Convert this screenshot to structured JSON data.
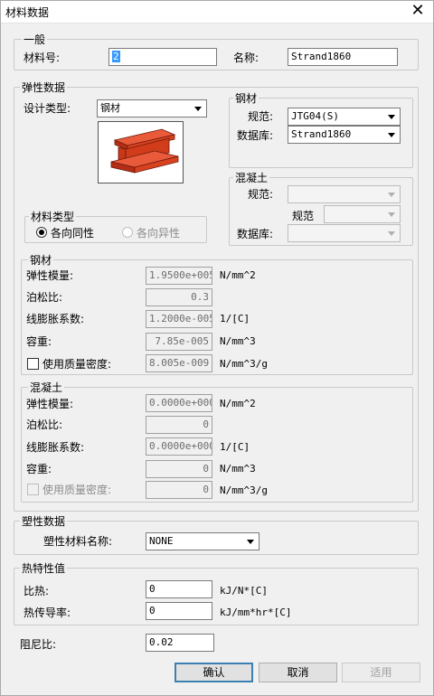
{
  "window": {
    "title": "材料数据",
    "close_glyph": "✕"
  },
  "general": {
    "legend": "一般",
    "material_no_label": "材料号:",
    "material_no_value": "2",
    "name_label": "名称:",
    "name_value": "Strand1860"
  },
  "elastic": {
    "legend": "弹性数据",
    "design_type_label": "设计类型:",
    "design_type_value": "钢材",
    "steel_box": {
      "legend": "钢材",
      "spec_label": "规范:",
      "spec_value": "JTG04(S)",
      "db_label": "数据库:",
      "db_value": "Strand1860"
    },
    "concrete_box": {
      "legend": "混凝土",
      "spec_label": "规范:",
      "spec2_label": "规范",
      "db_label": "数据库:"
    },
    "material_type": {
      "legend": "材料类型",
      "isotropic": "各向同性",
      "anisotropic": "各向异性"
    },
    "steel_props": {
      "legend": "钢材",
      "rows": [
        {
          "label": "弹性模量:",
          "value": "1.9500e+005",
          "unit": "N/mm^2"
        },
        {
          "label": "泊松比:",
          "value": "0.3",
          "unit": ""
        },
        {
          "label": "线膨胀系数:",
          "value": "1.2000e-005",
          "unit": "1/[C]"
        },
        {
          "label": "容重:",
          "value": "7.85e-005",
          "unit": "N/mm^3"
        },
        {
          "label": "使用质量密度:",
          "value": "8.005e-009",
          "unit": "N/mm^3/g"
        }
      ]
    },
    "concrete_props": {
      "legend": "混凝土",
      "rows": [
        {
          "label": "弹性模量:",
          "value": "0.0000e+000",
          "unit": "N/mm^2"
        },
        {
          "label": "泊松比:",
          "value": "0",
          "unit": ""
        },
        {
          "label": "线膨胀系数:",
          "value": "0.0000e+000",
          "unit": "1/[C]"
        },
        {
          "label": "容重:",
          "value": "0",
          "unit": "N/mm^3"
        },
        {
          "label": "使用质量密度:",
          "value": "0",
          "unit": "N/mm^3/g"
        }
      ]
    }
  },
  "plastic": {
    "legend": "塑性数据",
    "name_label": "塑性材料名称:",
    "name_value": "NONE"
  },
  "thermal": {
    "legend": "热特性值",
    "specific_heat_label": "比热:",
    "specific_heat_value": "0",
    "specific_heat_unit": "kJ/N*[C]",
    "conductivity_label": "热传导率:",
    "conductivity_value": "0",
    "conductivity_unit": "kJ/mm*hr*[C]"
  },
  "damping": {
    "label": "阻尼比:",
    "value": "0.02"
  },
  "buttons": {
    "ok": "确认",
    "cancel": "取消",
    "apply": "适用"
  },
  "colors": {
    "accent": "#3399ff",
    "beam_red": "#e03a1e"
  }
}
